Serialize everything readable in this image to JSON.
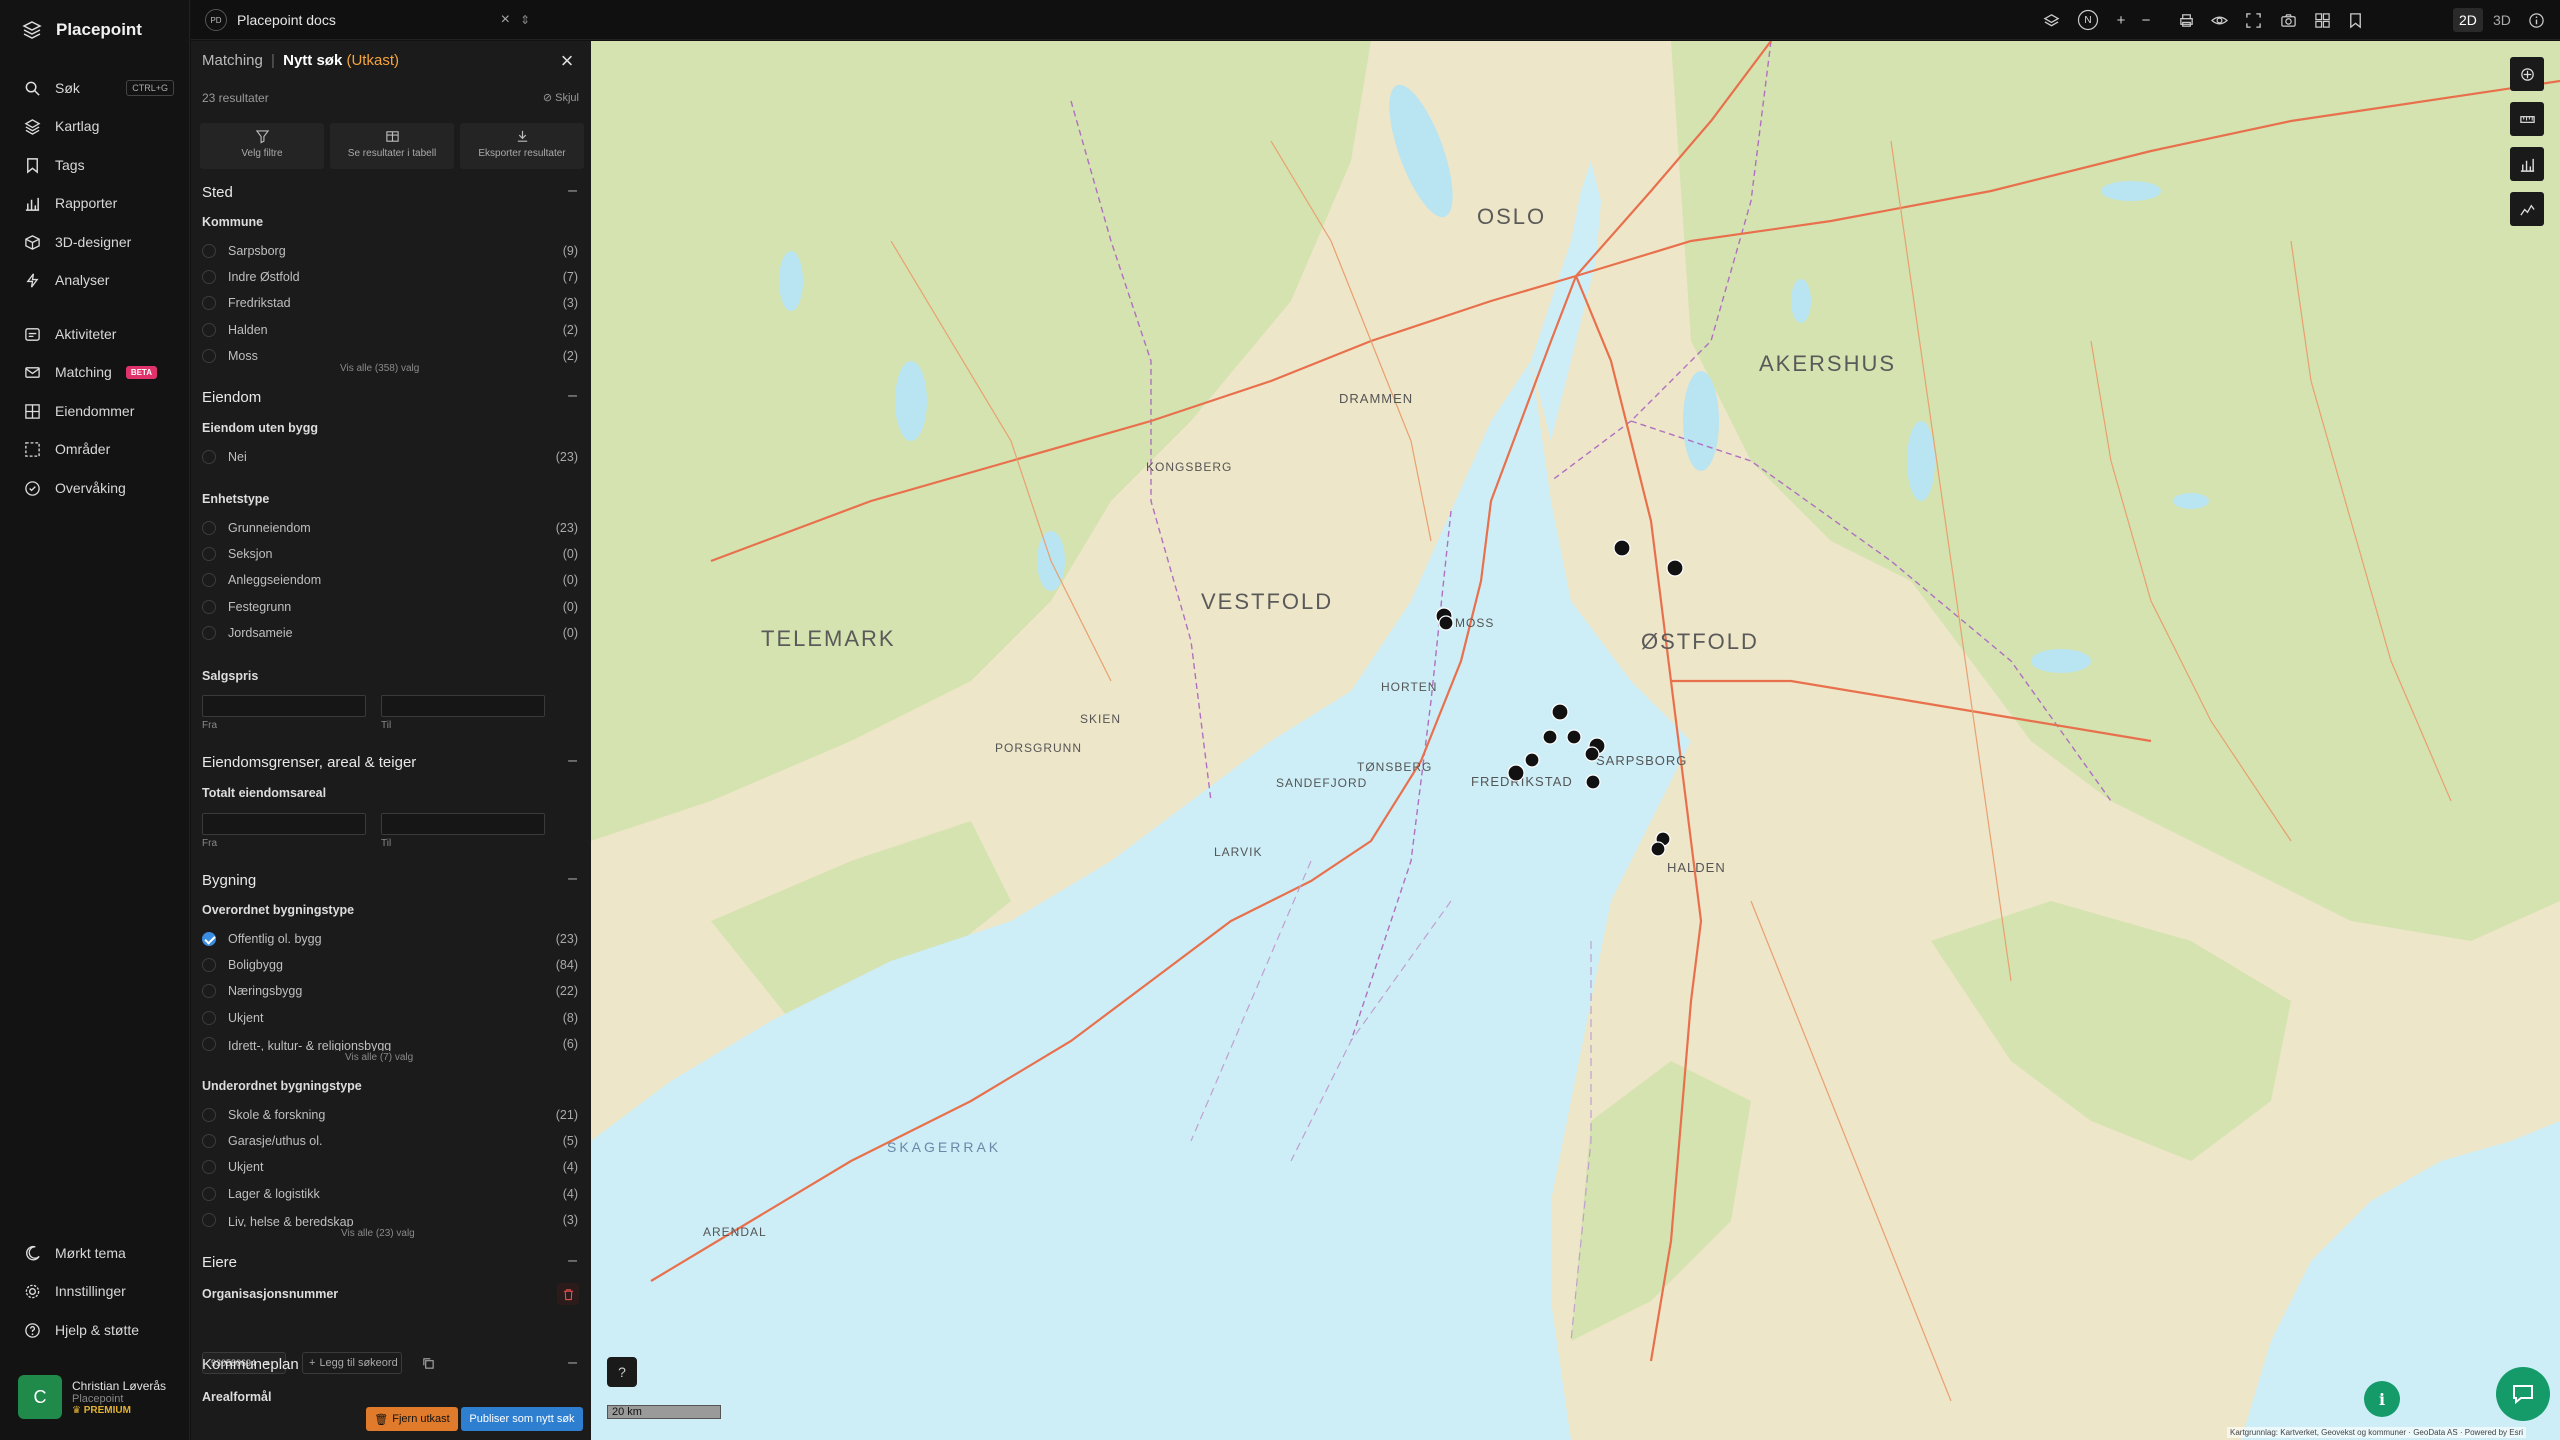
{
  "brand": "Placepoint",
  "nav": {
    "items": [
      {
        "label": "Søk",
        "shortcut": "CTRL+G"
      },
      {
        "label": "Kartlag"
      },
      {
        "label": "Tags"
      },
      {
        "label": "Rapporter"
      },
      {
        "label": "3D-designer"
      },
      {
        "label": "Analyser"
      },
      {
        "label": "Aktiviteter"
      },
      {
        "label": "Matching",
        "badge": "BETA"
      },
      {
        "label": "Eiendommer"
      },
      {
        "label": "Områder"
      },
      {
        "label": "Overvåking"
      }
    ],
    "bottom": [
      {
        "label": "Mørkt tema"
      },
      {
        "label": "Innstillinger"
      },
      {
        "label": "Hjelp & støtte"
      }
    ],
    "user": {
      "initial": "C",
      "name": "Christian Løverås",
      "org": "Placepoint",
      "plan": "PREMIUM"
    }
  },
  "topbar": {
    "doc_badge": "PD",
    "doc_name": "Placepoint docs",
    "mode_2d": "2D",
    "mode_3d": "3D",
    "compass": "N"
  },
  "panel": {
    "crumb_parent": "Matching",
    "crumb_sep": "|",
    "crumb_current": "Nytt søk",
    "crumb_status": "(Utkast)",
    "results": "23 resultater",
    "hide_label": "Skjul",
    "actions": [
      "Velg filtre",
      "Se resultater i tabell",
      "Eksporter resultater"
    ],
    "sections": {
      "sted": {
        "title": "Sted",
        "kommune_title": "Kommune",
        "kommune": [
          {
            "label": "Sarpsborg",
            "count": "(9)"
          },
          {
            "label": "Indre Østfold",
            "count": "(7)"
          },
          {
            "label": "Fredrikstad",
            "count": "(3)"
          },
          {
            "label": "Halden",
            "count": "(2)"
          },
          {
            "label": "Moss",
            "count": "(2)"
          }
        ],
        "show_all": "Vis alle (358) valg"
      },
      "eiendom": {
        "title": "Eiendom",
        "uten_bygg_title": "Eiendom uten bygg",
        "uten_bygg": [
          {
            "label": "Nei",
            "count": "(23)"
          }
        ],
        "enhetstype_title": "Enhetstype",
        "enhetstype": [
          {
            "label": "Grunneiendom",
            "count": "(23)"
          },
          {
            "label": "Seksjon",
            "count": "(0)"
          },
          {
            "label": "Anleggseiendom",
            "count": "(0)"
          },
          {
            "label": "Festegrunn",
            "count": "(0)"
          },
          {
            "label": "Jordsameie",
            "count": "(0)"
          }
        ],
        "salgspris_title": "Salgspris",
        "from": "Fra",
        "to": "Til"
      },
      "grenser": {
        "title": "Eiendomsgrenser, areal & teiger",
        "areal_title": "Totalt eiendomsareal",
        "from": "Fra",
        "to": "Til"
      },
      "bygning": {
        "title": "Bygning",
        "overordnet_title": "Overordnet bygningstype",
        "overordnet": [
          {
            "label": "Offentlig ol. bygg",
            "count": "(23)",
            "checked": true
          },
          {
            "label": "Boligbygg",
            "count": "(84)"
          },
          {
            "label": "Næringsbygg",
            "count": "(22)"
          },
          {
            "label": "Ukjent",
            "count": "(8)"
          },
          {
            "label": "Idrett-, kultur- & religionsbygg",
            "count": "(6)"
          }
        ],
        "overordnet_show_all": "Vis alle (7) valg",
        "underordnet_title": "Underordnet bygningstype",
        "underordnet": [
          {
            "label": "Skole & forskning",
            "count": "(21)"
          },
          {
            "label": "Garasje/uthus ol.",
            "count": "(5)"
          },
          {
            "label": "Ukjent",
            "count": "(4)"
          },
          {
            "label": "Lager & logistikk",
            "count": "(4)"
          },
          {
            "label": "Liv, helse & beredskap",
            "count": "(3)"
          }
        ],
        "underordnet_show_all": "Vis alle (23) valg"
      },
      "eiere": {
        "title": "Eiere",
        "org_title": "Organisasjonsnummer",
        "chip": "930580694",
        "add_keyword": "Legg til søkeord"
      },
      "kommuneplan": {
        "title": "Kommuneplan",
        "areal_title": "Arealformål"
      }
    },
    "remove_btn": "Fjern utkast",
    "publish_btn": "Publiser som nytt søk"
  },
  "map": {
    "scale": "20 km",
    "attribution": "Kartgrunnlag: Kartverket, Geovekst og kommuner · GeoData AS · Powered by Esri",
    "regions": [
      "OSLO",
      "AKERSHUS",
      "VESTFOLD",
      "TELEMARK",
      "ØSTFOLD"
    ],
    "sea_label": "SKAGERRAK",
    "places": [
      "DRAMMEN",
      "KONGSBERG",
      "HORTEN",
      "MOSS",
      "TØNSBERG",
      "SKIEN",
      "PORSGRUNN",
      "SANDEFJORD",
      "LARVIK",
      "FREDRIKSTAD",
      "SARPSBORG",
      "HALDEN",
      "ARENDAL"
    ],
    "colors": {
      "land": "#f1ead1",
      "forest": "#d6e5b4",
      "water": "#cdeef7",
      "road": "#e86a4a",
      "marker": "#111111"
    }
  }
}
